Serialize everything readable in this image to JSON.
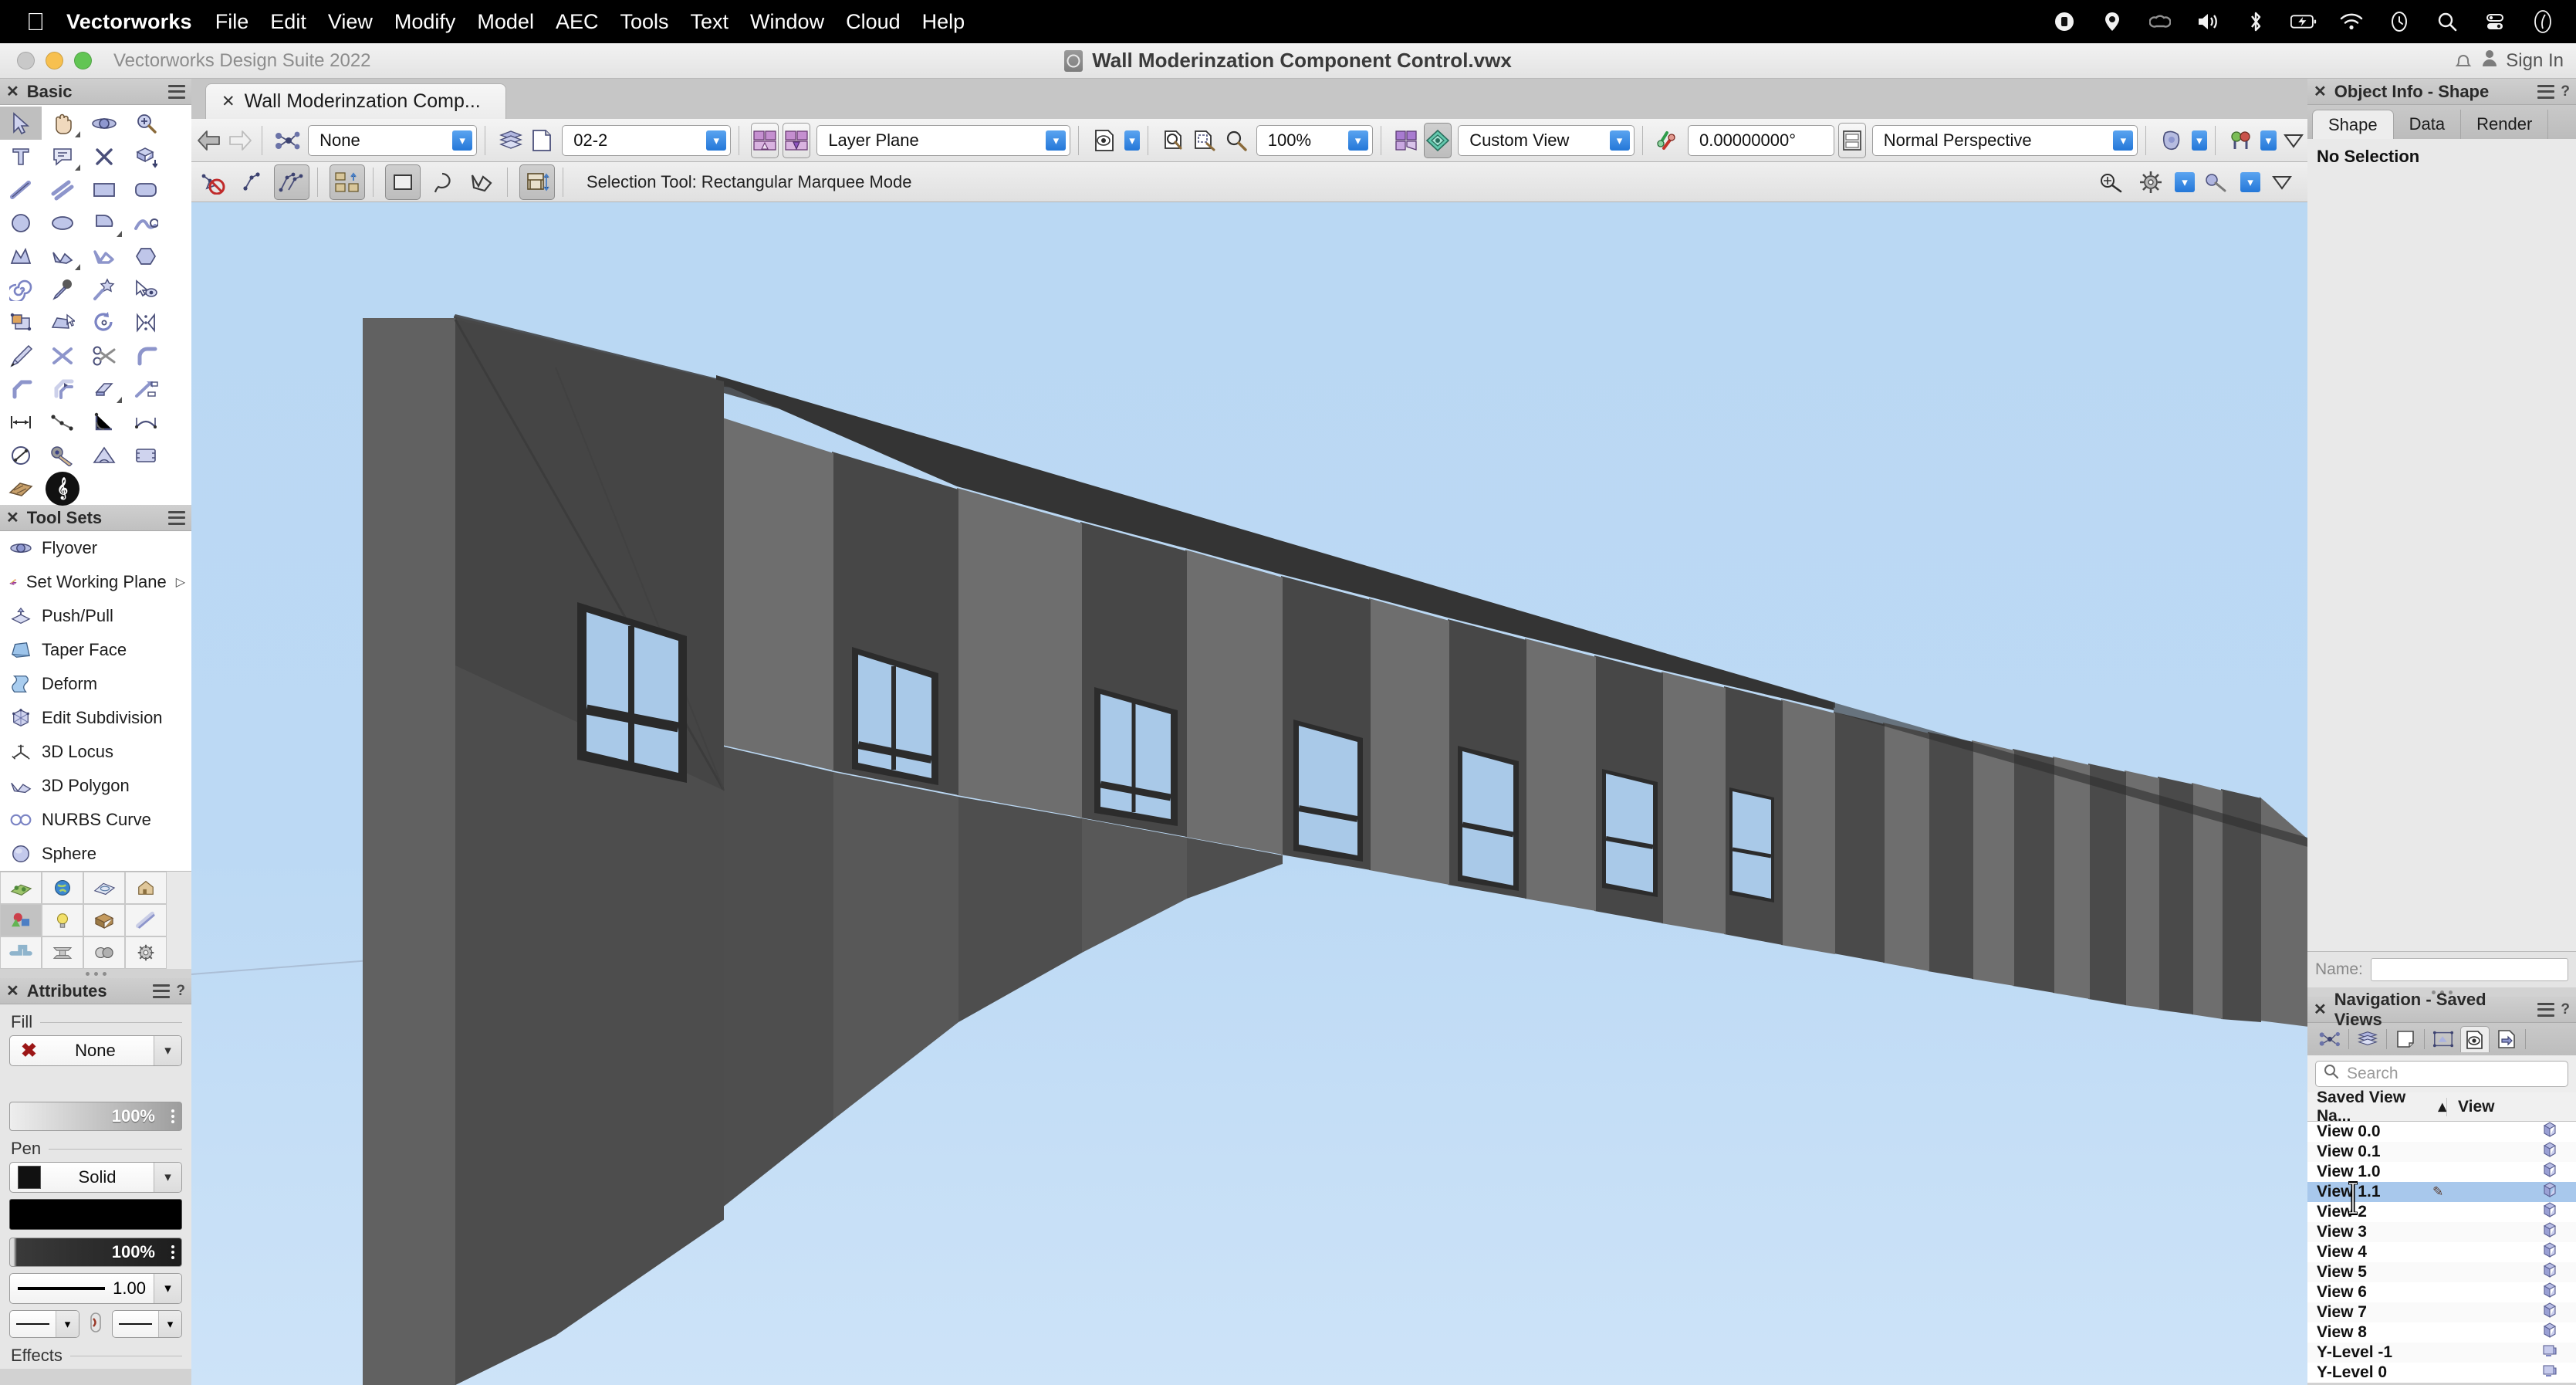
{
  "macbar": {
    "app_name": "Vectorworks",
    "menus": [
      "File",
      "Edit",
      "View",
      "Modify",
      "Model",
      "AEC",
      "Tools",
      "Text",
      "Window",
      "Cloud",
      "Help"
    ],
    "status_icons": [
      "record-icon",
      "location-icon",
      "creative-cloud-icon",
      "volume-icon",
      "bluetooth-icon",
      "battery-charging-icon",
      "wifi-icon",
      "time-machine-icon",
      "spotlight-search-icon",
      "control-center-icon",
      "siri-icon"
    ]
  },
  "titlebar": {
    "subtitle": "Vectorworks Design Suite 2022",
    "document_title": "Wall Moderinzation Component Control.vwx",
    "signin_label": "Sign In"
  },
  "tab": {
    "label": "Wall Moderinzation Comp..."
  },
  "toolbar": {
    "class_value": "None",
    "layer_value": "02-2",
    "plane_value": "Layer Plane",
    "zoom_value": "100%",
    "view_value": "Custom View",
    "angle_value": "0.00000000°",
    "projection_value": "Normal Perspective",
    "icons": [
      "back-arrow-icon",
      "forward-arrow-icon",
      "class-icon",
      "layers-icon",
      "layer-page-icon",
      "saved-view-icon",
      "working-plane-icon",
      "plane-snap-icon",
      "render-page-icon",
      "fit-to-window-icon",
      "zoom-selection-icon",
      "magnifier-icon",
      "layer-options-icon",
      "render-mode-icon",
      "lighting-icon",
      "camera-icon",
      "flyover-preset-icon",
      "overflow-chevron-icon"
    ]
  },
  "modebar": {
    "status": "Selection Tool: Rectangular Marquee Mode",
    "icons": [
      "no-snap-icon",
      "single-object-icon",
      "multi-object-icon",
      "group-mode-icon",
      "rect-marquee-icon",
      "lasso-icon",
      "polygon-marquee-icon",
      "section-mode-icon",
      "snap-settings-icon",
      "settings-gear-icon",
      "attribute-tool-icon",
      "more-tools-icon",
      "overflow-chevron-icon"
    ]
  },
  "basic_palette": {
    "title": "Basic",
    "tools": [
      [
        "selection-arrow-icon",
        "pan-hand-icon",
        "flyover-orbit-icon",
        "zoom-in-icon"
      ],
      [
        "text-tool-icon",
        "callout-icon",
        "delete-x-icon",
        "extrude-icon"
      ],
      [
        "line-tool-icon",
        "double-line-icon",
        "rectangle-icon",
        "rounded-rect-icon"
      ],
      [
        "circle-icon",
        "ellipse-icon",
        "arc-icon",
        "spline-icon"
      ],
      [
        "polygon-icon",
        "polyline-icon",
        "freehand-icon",
        "regular-polygon-icon"
      ],
      [
        "spiral-icon",
        "eyedropper-icon",
        "magic-wand-icon",
        "select-similar-icon"
      ],
      [
        "scale-objects-icon",
        "mirror-reshape-icon",
        "rotate-icon",
        "mirror-icon"
      ],
      [
        "pen-tool-icon",
        "trim-icon",
        "split-scissors-icon",
        "fillet-icon"
      ],
      [
        "chamfer-icon",
        "offset-icon",
        "eraser-icon",
        "connect-combine-icon"
      ],
      [
        "linear-dimension-icon",
        "chain-dimension-icon",
        "angular-dimension-icon",
        "arc-dimension-icon"
      ],
      [
        "diameter-dimension-icon",
        "selector-key-icon",
        "protractor-icon",
        "interior-elevation-icon"
      ],
      [
        "hardscape-icon",
        "unreal-live-link-icon",
        "",
        ""
      ]
    ],
    "selected_index": [
      0,
      0
    ]
  },
  "tool_sets": {
    "title": "Tool Sets",
    "items": [
      {
        "label": "Flyover",
        "icon": "flyover-orbit-icon"
      },
      {
        "label": "Set Working Plane",
        "icon": "working-plane-icon",
        "has_submenu": true
      },
      {
        "label": "Push/Pull",
        "icon": "push-pull-icon"
      },
      {
        "label": "Taper Face",
        "icon": "taper-face-icon"
      },
      {
        "label": "Deform",
        "icon": "deform-icon"
      },
      {
        "label": "Edit Subdivision",
        "icon": "edit-subdivision-icon"
      },
      {
        "label": "3D Locus",
        "icon": "3d-locus-icon"
      },
      {
        "label": "3D Polygon",
        "icon": "3d-polygon-icon"
      },
      {
        "label": "NURBS Curve",
        "icon": "nurbs-curve-icon"
      },
      {
        "label": "Sphere",
        "icon": "sphere-icon"
      }
    ],
    "grid_icons": [
      [
        "site-planning-icon",
        "world-globe-icon",
        "terrain-icon",
        "building-shell-icon"
      ],
      [
        "3d-modeling-icon",
        "lighting-bulb-icon",
        "furniture-box-icon",
        "dims-notes-icon"
      ],
      [
        "pipes-icon",
        "steel-beam-icon",
        "detailing-icon",
        "machine-design-icon"
      ]
    ],
    "grid_selected": [
      1,
      0
    ]
  },
  "attributes": {
    "title": "Attributes",
    "fill_label": "Fill",
    "fill_value": "None",
    "fill_opacity": "100%",
    "pen_label": "Pen",
    "pen_value": "Solid",
    "pen_opacity": "100%",
    "line_weight": "1.00",
    "effects_label": "Effects"
  },
  "object_info": {
    "title": "Object Info - Shape",
    "tabs": [
      "Shape",
      "Data",
      "Render"
    ],
    "selected_tab": "Shape",
    "status": "No Selection",
    "name_label": "Name:",
    "name_value": ""
  },
  "navigation": {
    "title": "Navigation - Saved Views",
    "tool_icons": [
      "classes-icon",
      "design-layers-icon",
      "sheet-layers-icon",
      "viewports-icon",
      "saved-views-icon",
      "references-icon"
    ],
    "selected_tool": "saved-views-icon",
    "search_placeholder": "Search",
    "columns": [
      "Saved View Na...",
      "View"
    ],
    "sort_indicator": "ascending",
    "rows": [
      {
        "name": "View 0.0",
        "icon": "cube-icon"
      },
      {
        "name": "View 0.1",
        "icon": "cube-icon"
      },
      {
        "name": "View 1.0",
        "icon": "cube-icon"
      },
      {
        "name": "View 1.1",
        "icon": "cube-icon",
        "selected": true,
        "edit_icon": "pencil-icon"
      },
      {
        "name": "View 2",
        "icon": "cube-icon"
      },
      {
        "name": "View 3",
        "icon": "cube-icon"
      },
      {
        "name": "View 4",
        "icon": "cube-icon"
      },
      {
        "name": "View 5",
        "icon": "cube-icon"
      },
      {
        "name": "View 6",
        "icon": "cube-icon"
      },
      {
        "name": "View 7",
        "icon": "cube-icon"
      },
      {
        "name": "View 8",
        "icon": "cube-icon"
      },
      {
        "name": "Y-Level -1",
        "icon": "viewport-icon"
      },
      {
        "name": "Y-Level 0",
        "icon": "viewport-icon"
      }
    ]
  },
  "canvas": {
    "description": "3D perspective render of a modular wall facade receding toward a vanishing point",
    "sky_color_top": "#bcd9f4",
    "sky_color_bottom": "#cbe2f7",
    "wall_color_front": "#4b4b4b",
    "wall_color_side": "#6e6e6e",
    "wall_color_top": "#3f3f3f",
    "glass_color": "#a9c9e8",
    "panel_count": 18
  }
}
